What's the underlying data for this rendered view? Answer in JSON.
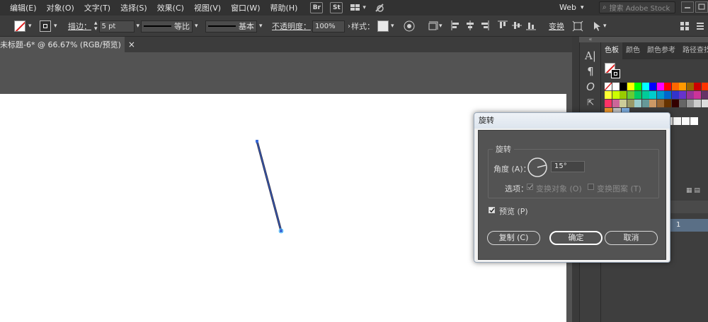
{
  "menubar": {
    "items": [
      "编辑(E)",
      "对象(O)",
      "文字(T)",
      "选择(S)",
      "效果(C)",
      "视图(V)",
      "窗口(W)",
      "帮助(H)"
    ],
    "bridge_badge": "Br",
    "stock_badge": "St",
    "workspace": "Web",
    "search_placeholder": "搜索 Adobe Stock"
  },
  "controlbar": {
    "stroke_label": "描边：",
    "stroke_value": "5 pt",
    "profile_label": "等比",
    "brush_label": "基本",
    "opacity_label": "不透明度：",
    "opacity_value": "100%",
    "style_label": "样式：",
    "transform_label": "变换"
  },
  "document": {
    "tab_title": "未标题-6* @ 66.67% (RGB/预览)",
    "close_glyph": "×"
  },
  "panel": {
    "tabs": [
      "色板",
      "颜色",
      "颜色参考",
      "路径查找"
    ],
    "layer_label": "1",
    "dock_glyphs": [
      "A|",
      "¶",
      "O",
      "⇱"
    ]
  },
  "dialog": {
    "title": "旋转",
    "group_title": "旋转",
    "angle_label": "角度 (A)：",
    "angle_value": "15°",
    "options_label": "选项：",
    "transform_objects": "变换对象 (O)",
    "transform_patterns": "变换图案 (T)",
    "preview_label": "预览 (P)",
    "copy_button": "复制 (C)",
    "ok_button": "确定",
    "cancel_button": "取消",
    "preview_checked": true,
    "transform_objects_checked": true,
    "transform_patterns_checked": false
  },
  "colors": {
    "swatch_row1": [
      "#ffffff",
      "#ffffff",
      "#000000",
      "#ffff00",
      "#00ff00",
      "#00ffff",
      "#0000ff",
      "#ff00ff",
      "#ff0000",
      "#ff6600",
      "#ff9900",
      "#996600",
      "#cc0000",
      "#ff3300"
    ],
    "swatch_row2": [
      "#ffff33",
      "#ccff00",
      "#99cc00",
      "#66cc33",
      "#00cc66",
      "#00cc99",
      "#00cccc",
      "#0099cc",
      "#0066cc",
      "#3333cc",
      "#6633cc",
      "#993399",
      "#cc3399",
      "#663366"
    ],
    "swatch_row3": [
      "#ff3366",
      "#cc6699",
      "#cccc99",
      "#999966",
      "#99cccc",
      "#669999",
      "#cc9966",
      "#996633",
      "#663300",
      "#330000",
      "#666666",
      "#999999",
      "#cccccc",
      "#dddddd"
    ]
  }
}
